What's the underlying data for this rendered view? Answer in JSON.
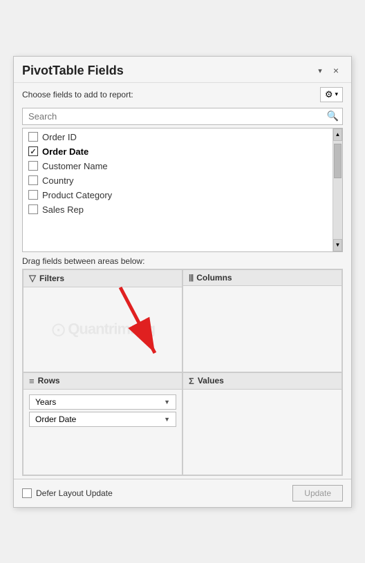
{
  "header": {
    "title": "PivotTable Fields",
    "close_label": "×",
    "dropdown_arrow": "▾"
  },
  "choose_fields": {
    "label": "Choose fields to add to report:",
    "gear_icon": "⚙",
    "dropdown_arrow": "▾"
  },
  "search": {
    "placeholder": "Search",
    "icon": "🔍"
  },
  "fields": [
    {
      "id": "order-id",
      "label": "Order ID",
      "checked": false
    },
    {
      "id": "order-date",
      "label": "Order Date",
      "checked": true,
      "bold": true
    },
    {
      "id": "customer-name",
      "label": "Customer Name",
      "checked": false
    },
    {
      "id": "country",
      "label": "Country",
      "checked": false
    },
    {
      "id": "product-category",
      "label": "Product Category",
      "checked": false
    },
    {
      "id": "sales-rep",
      "label": "Sales Rep",
      "checked": false
    }
  ],
  "drag_label": "Drag fields between areas below:",
  "areas": {
    "filters": {
      "label": "Filters",
      "icon": "▽"
    },
    "columns": {
      "label": "Columns",
      "icon": "|||"
    },
    "rows": {
      "label": "Rows",
      "icon": "≡"
    },
    "values": {
      "label": "Values",
      "icon": "Σ"
    }
  },
  "rows_chips": [
    {
      "label": "Years",
      "arrow": "▼"
    },
    {
      "label": "Order Date",
      "arrow": "▼"
    }
  ],
  "watermark": {
    "icon": "⊙",
    "text": "Quantrimang"
  },
  "footer": {
    "defer_label": "Defer Layout Update",
    "update_label": "Update"
  }
}
